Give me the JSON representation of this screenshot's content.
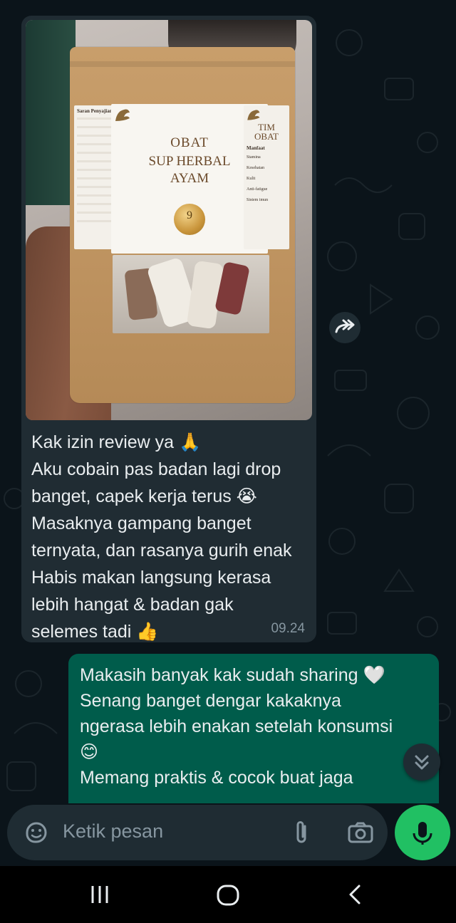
{
  "incoming_message": {
    "lines": [
      "Kak izin review ya 🙏",
      "Aku cobain pas badan lagi drop",
      "banget, capek kerja terus 😭",
      "Masaknya gampang banget",
      "ternyata, dan rasanya gurih enak",
      "Habis makan langsung kerasa",
      "lebih hangat & badan gak",
      "selemes tadi 👍"
    ],
    "time": "09.24"
  },
  "product_photo": {
    "brand_line1": "OBAT",
    "brand_line2": "SUP HERBAL",
    "brand_line3": "AYAM",
    "side_brand_line1": "TIM",
    "side_brand_line2": "OBAT",
    "medal_number": "9",
    "left_panel_title": "Saran Penyajian",
    "right_panel_title": "Manfaat",
    "benefits": [
      "Stamina",
      "Kesehatan",
      "Kulit",
      "Anti-fatigue",
      "Sistem imun"
    ]
  },
  "outgoing_message": {
    "lines": [
      "Makasih banyak kak sudah sharing 🤍",
      "Senang banget dengar kakaknya",
      "ngerasa lebih enakan setelah konsumsi",
      "😊",
      "Memang praktis & cocok buat jaga"
    ]
  },
  "composer": {
    "placeholder": "Ketik pesan"
  },
  "icons": {
    "forward": "forward-icon",
    "scroll_down": "double-chevron-down-icon",
    "emoji": "sticker-icon",
    "attach": "paperclip-icon",
    "camera": "camera-icon",
    "mic": "mic-icon"
  },
  "colors": {
    "background": "#0b141a",
    "incoming_bubble": "#202c33",
    "outgoing_bubble": "#005c4b",
    "mic_button": "#21c063",
    "text": "#e9edef",
    "meta_text": "#8696a0"
  }
}
